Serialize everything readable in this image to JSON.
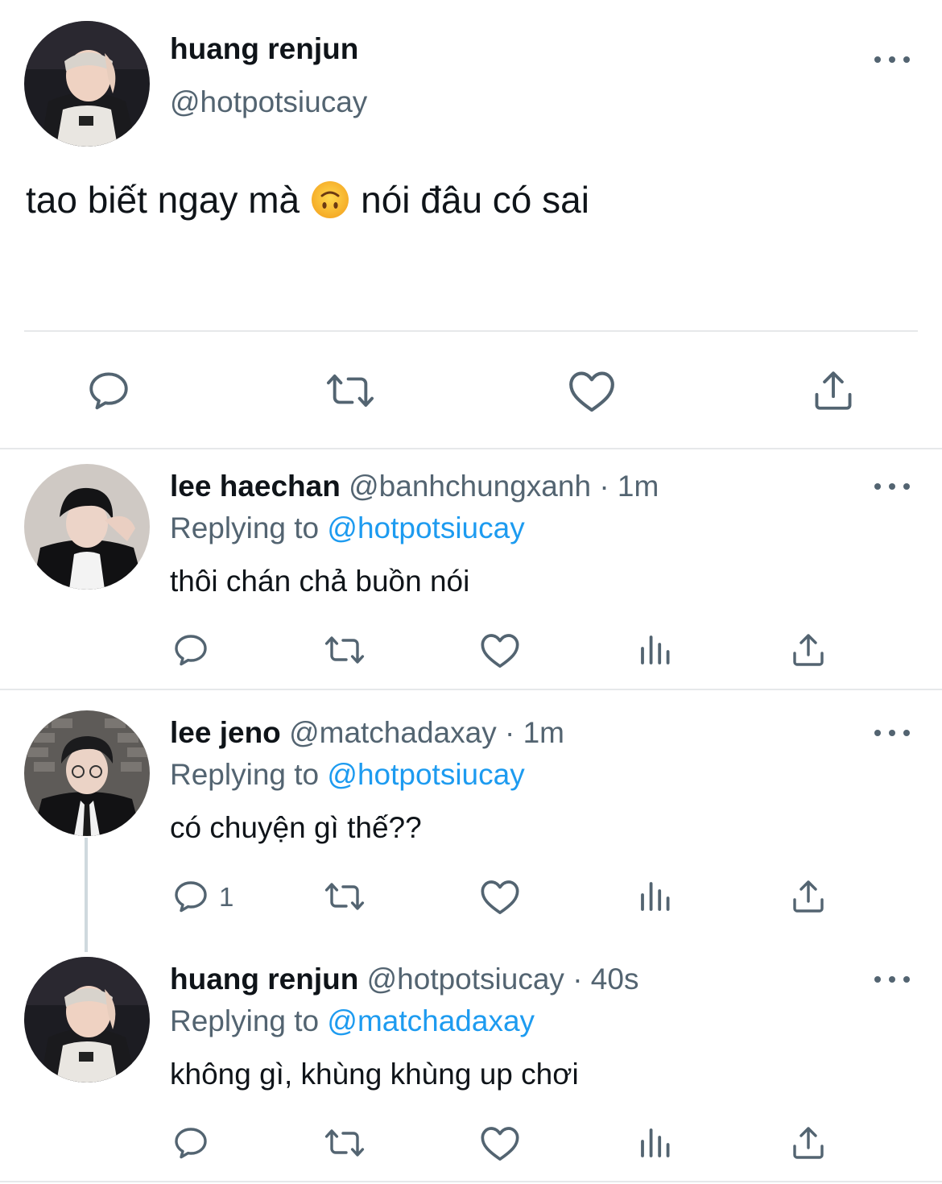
{
  "main_tweet": {
    "display_name": "huang renjun",
    "handle": "@hotpotsiucay",
    "text_before": "tao biết ngay mà",
    "emoji": "upside-down-face",
    "text_after": "nói đâu có sai"
  },
  "replies": [
    {
      "display_name": "lee haechan",
      "handle": "@banhchungxanh",
      "time": "· 1m",
      "replying_label": "Replying to",
      "replying_to": "@hotpotsiucay",
      "text": "thôi chán chả buồn nói",
      "reply_count": ""
    },
    {
      "display_name": "lee jeno",
      "handle": "@matchadaxay",
      "time": "· 1m",
      "replying_label": "Replying to",
      "replying_to": "@hotpotsiucay",
      "text": "có chuyện gì thế??",
      "reply_count": "1"
    },
    {
      "display_name": "huang renjun",
      "handle": "@hotpotsiucay",
      "time": "· 40s",
      "replying_label": "Replying to",
      "replying_to": "@matchadaxay",
      "text": "không gì, khùng khùng up chơi",
      "reply_count": ""
    }
  ],
  "colors": {
    "text": "#0f1419",
    "muted": "#536471",
    "link": "#1d9bf0",
    "divider": "#e6e8ea"
  }
}
